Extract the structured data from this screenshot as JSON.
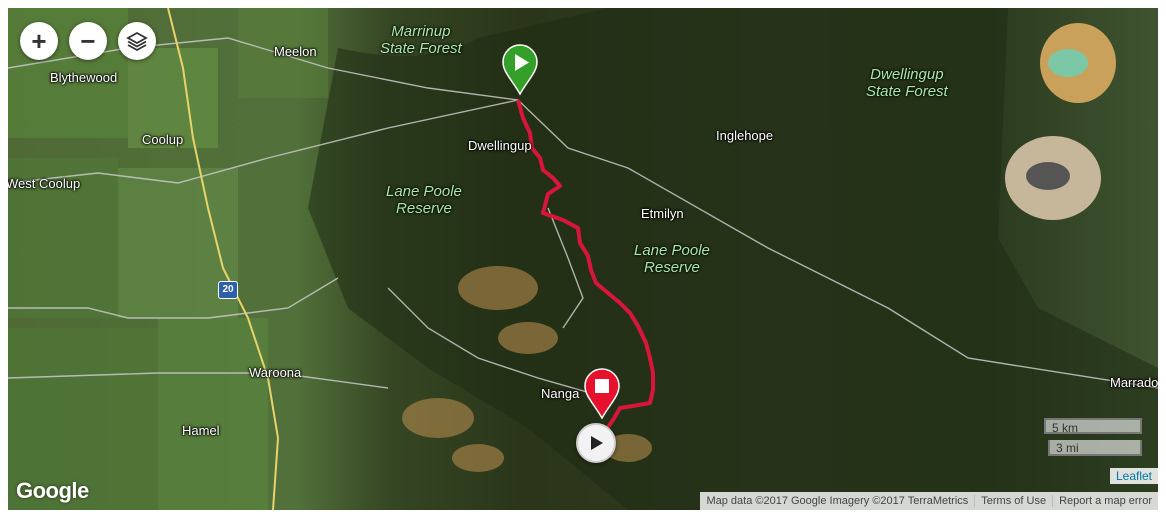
{
  "controls": {
    "zoom_in_label": "+",
    "zoom_out_label": "−",
    "layers_icon": "layers-icon"
  },
  "places": [
    {
      "id": "meelon",
      "label": "Meelon"
    },
    {
      "id": "blythewood",
      "label": "Blythewood"
    },
    {
      "id": "coolup",
      "label": "Coolup"
    },
    {
      "id": "west-coolup",
      "label": "West Coolup"
    },
    {
      "id": "dwellingup",
      "label": "Dwellingup"
    },
    {
      "id": "inglehope",
      "label": "Inglehope"
    },
    {
      "id": "etmilyn",
      "label": "Etmilyn"
    },
    {
      "id": "waroona",
      "label": "Waroona"
    },
    {
      "id": "hamel",
      "label": "Hamel"
    },
    {
      "id": "nanga",
      "label": "Nanga"
    },
    {
      "id": "marradong",
      "label": "Marrado"
    }
  ],
  "parks": [
    {
      "id": "marrinup",
      "line1": "Marrinup",
      "line2": "State Forest"
    },
    {
      "id": "dwellingup-sf",
      "line1": "Dwellingup",
      "line2": "State Forest"
    },
    {
      "id": "lane-poole-west",
      "line1": "Lane Poole",
      "line2": "Reserve"
    },
    {
      "id": "lane-poole-east",
      "line1": "Lane Poole",
      "line2": "Reserve"
    }
  ],
  "highway_shield": "20",
  "route": {
    "color": "#d9163a",
    "start_color": "#34a02a",
    "end_color": "#e8112d"
  },
  "scale": {
    "km": "5 km",
    "mi": "3 mi"
  },
  "attribution": {
    "leaflet": "Leaflet",
    "map_data": "Map data ©2017 Google Imagery ©2017 TerraMetrics",
    "terms": "Terms of Use",
    "report": "Report a map error"
  },
  "google_logo": "Google"
}
